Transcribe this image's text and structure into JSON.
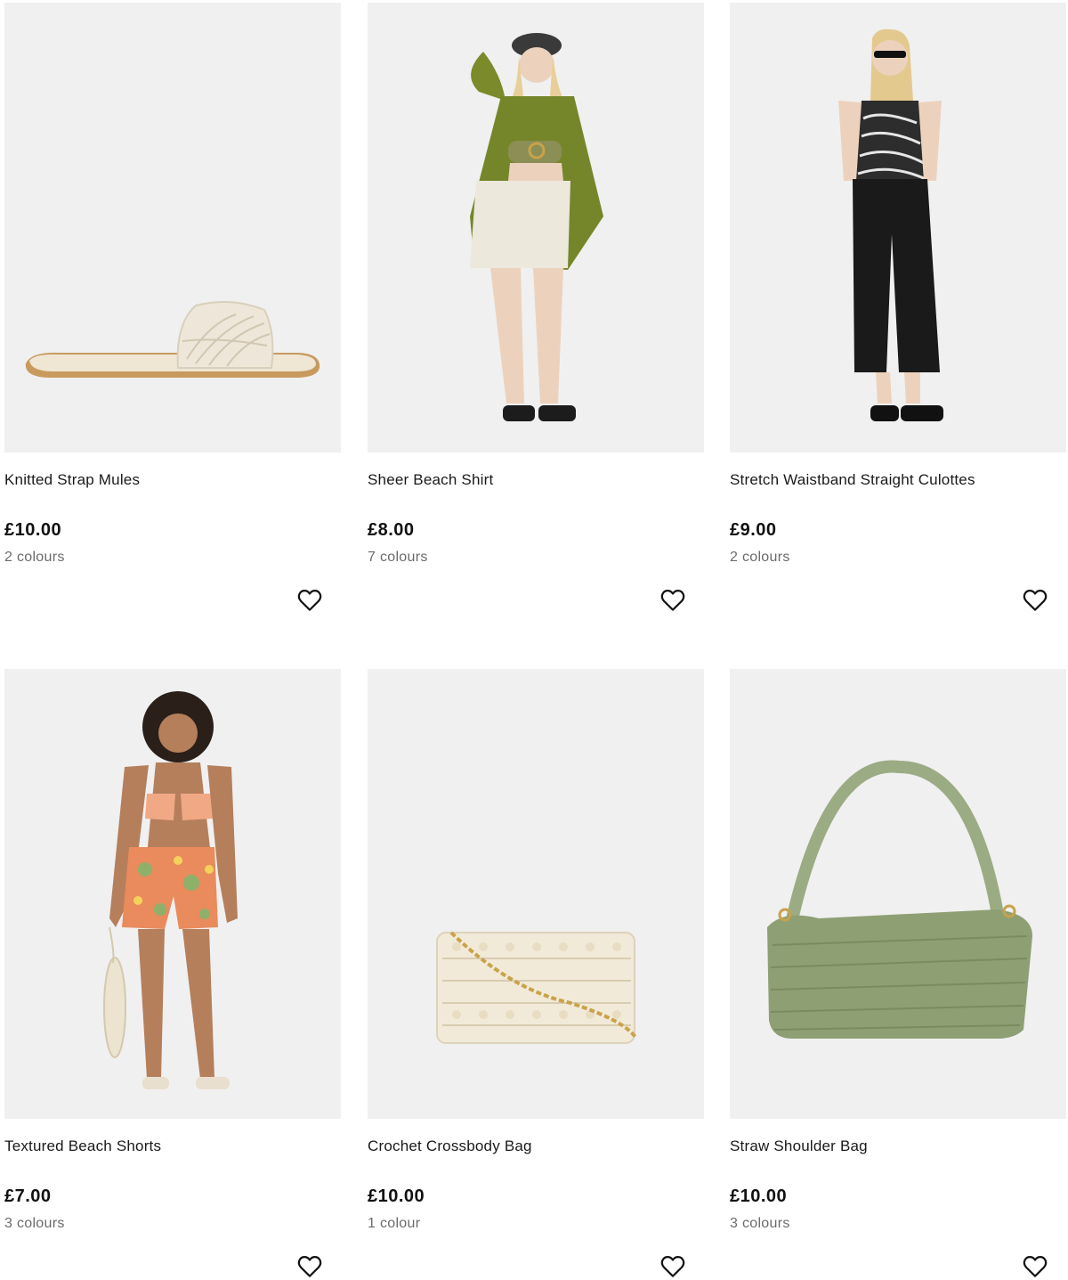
{
  "products": [
    {
      "name": "Knitted Strap Mules",
      "price": "£10.00",
      "colours": "2 colours",
      "image_icon": "sandal-image"
    },
    {
      "name": "Sheer Beach Shirt",
      "price": "£8.00",
      "colours": "7 colours",
      "image_icon": "model-shirt-image"
    },
    {
      "name": "Stretch Waistband Straight Culottes",
      "price": "£9.00",
      "colours": "2 colours",
      "image_icon": "model-culottes-image"
    },
    {
      "name": "Textured Beach Shorts",
      "price": "£7.00",
      "colours": "3 colours",
      "image_icon": "model-shorts-image"
    },
    {
      "name": "Crochet Crossbody Bag",
      "price": "£10.00",
      "colours": "1 colour",
      "image_icon": "crossbody-bag-image"
    },
    {
      "name": "Straw Shoulder Bag",
      "price": "£10.00",
      "colours": "3 colours",
      "image_icon": "shoulder-bag-image"
    }
  ],
  "wishlist_icon": "heart-outline-icon",
  "colors": {
    "image_bg": "#f0f0f0",
    "text": "#1a1a1a",
    "muted": "#6b6b6b"
  }
}
